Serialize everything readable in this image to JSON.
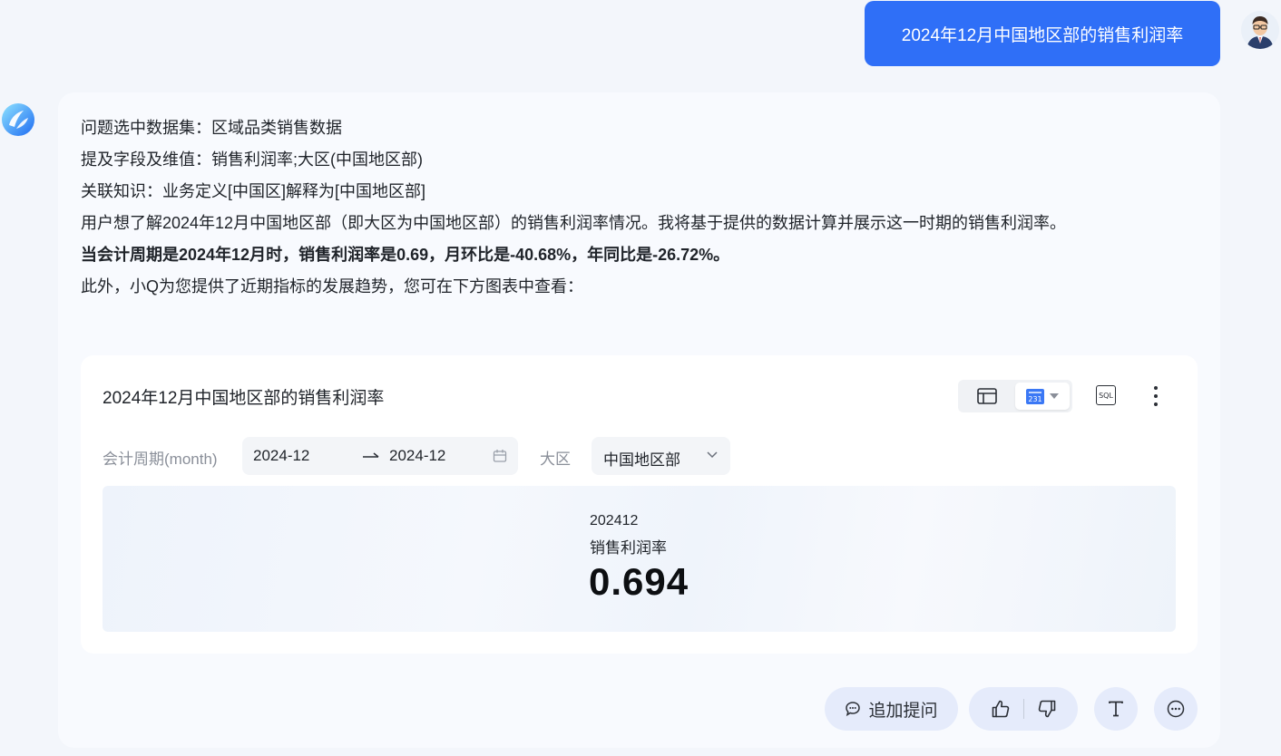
{
  "user_message": {
    "text": "2024年12月中国地区部的销售利润率"
  },
  "assistant": {
    "lines": {
      "dataset": "问题选中数据集：区域品类销售数据",
      "fields": "提及字段及维值：销售利润率;大区(中国地区部)",
      "knowledge": "关联知识：业务定义[中国区]解释为[中国地区部]",
      "intent": "用户想了解2024年12月中国地区部（即大区为中国地区部）的销售利润率情况。我将基于提供的数据计算并展示这一时期的销售利润率。",
      "conclusion": "当会计周期是2024年12月时，销售利润率是0.69，月环比是-40.68%，年同比是-26.72%。",
      "trend_hint": "此外，小Q为您提供了近期指标的发展趋势，您可在下方图表中查看："
    },
    "widget": {
      "title": "2024年12月中国地区部的销售利润率",
      "kpi_icon_text": "231",
      "sql_label": "SQL",
      "filters": {
        "period_label": "会计周期(month)",
        "date_from": "2024-12",
        "date_to": "2024-12",
        "region_label": "大区",
        "region_value": "中国地区部"
      },
      "kpi": {
        "period": "202412",
        "metric_name": "销售利润率",
        "value": "0.694"
      }
    },
    "actions": {
      "followup_label": "追加提问"
    }
  },
  "icons": {
    "user_avatar": "avatar-icon",
    "bot_avatar": "assistant-logo-icon",
    "table_view": "table-icon",
    "kpi_view": "kpi-card-icon",
    "sql": "sql-icon",
    "more": "more-vertical-icon",
    "calendar": "calendar-icon",
    "chevron": "chevron-down-icon",
    "followup": "chat-bubble-icon",
    "like": "thumbs-up-icon",
    "dislike": "thumbs-down-icon",
    "text_mode": "text-format-icon",
    "more_chat": "more-horizontal-icon"
  },
  "colors": {
    "accent": "#2f6ff7",
    "pill_bg": "#e5ebfb",
    "page_bg": "#f3f6fb"
  }
}
